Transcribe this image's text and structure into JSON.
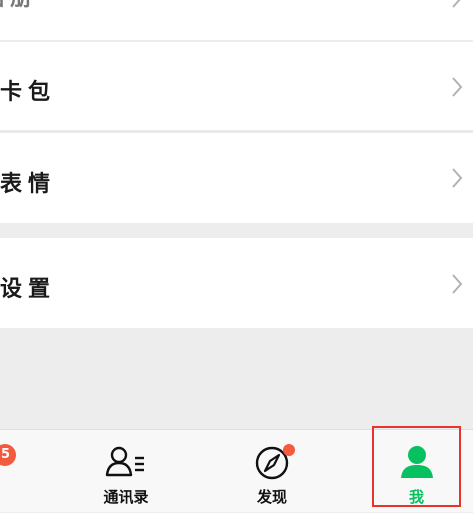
{
  "menu": {
    "items": [
      {
        "label": "相册"
      },
      {
        "label": "卡包"
      },
      {
        "label": "表情"
      },
      {
        "label": "设置"
      }
    ]
  },
  "tabbar": {
    "chats_badge": "5",
    "tabs": [
      {
        "label": "通讯录",
        "icon": "contacts-icon"
      },
      {
        "label": "发现",
        "icon": "compass-icon",
        "has_dot": true
      },
      {
        "label": "我",
        "icon": "person-icon",
        "active": true
      }
    ]
  },
  "colors": {
    "accent": "#07c160",
    "badge": "#f35a3e",
    "highlight": "#e8342a",
    "background": "#ededed"
  }
}
